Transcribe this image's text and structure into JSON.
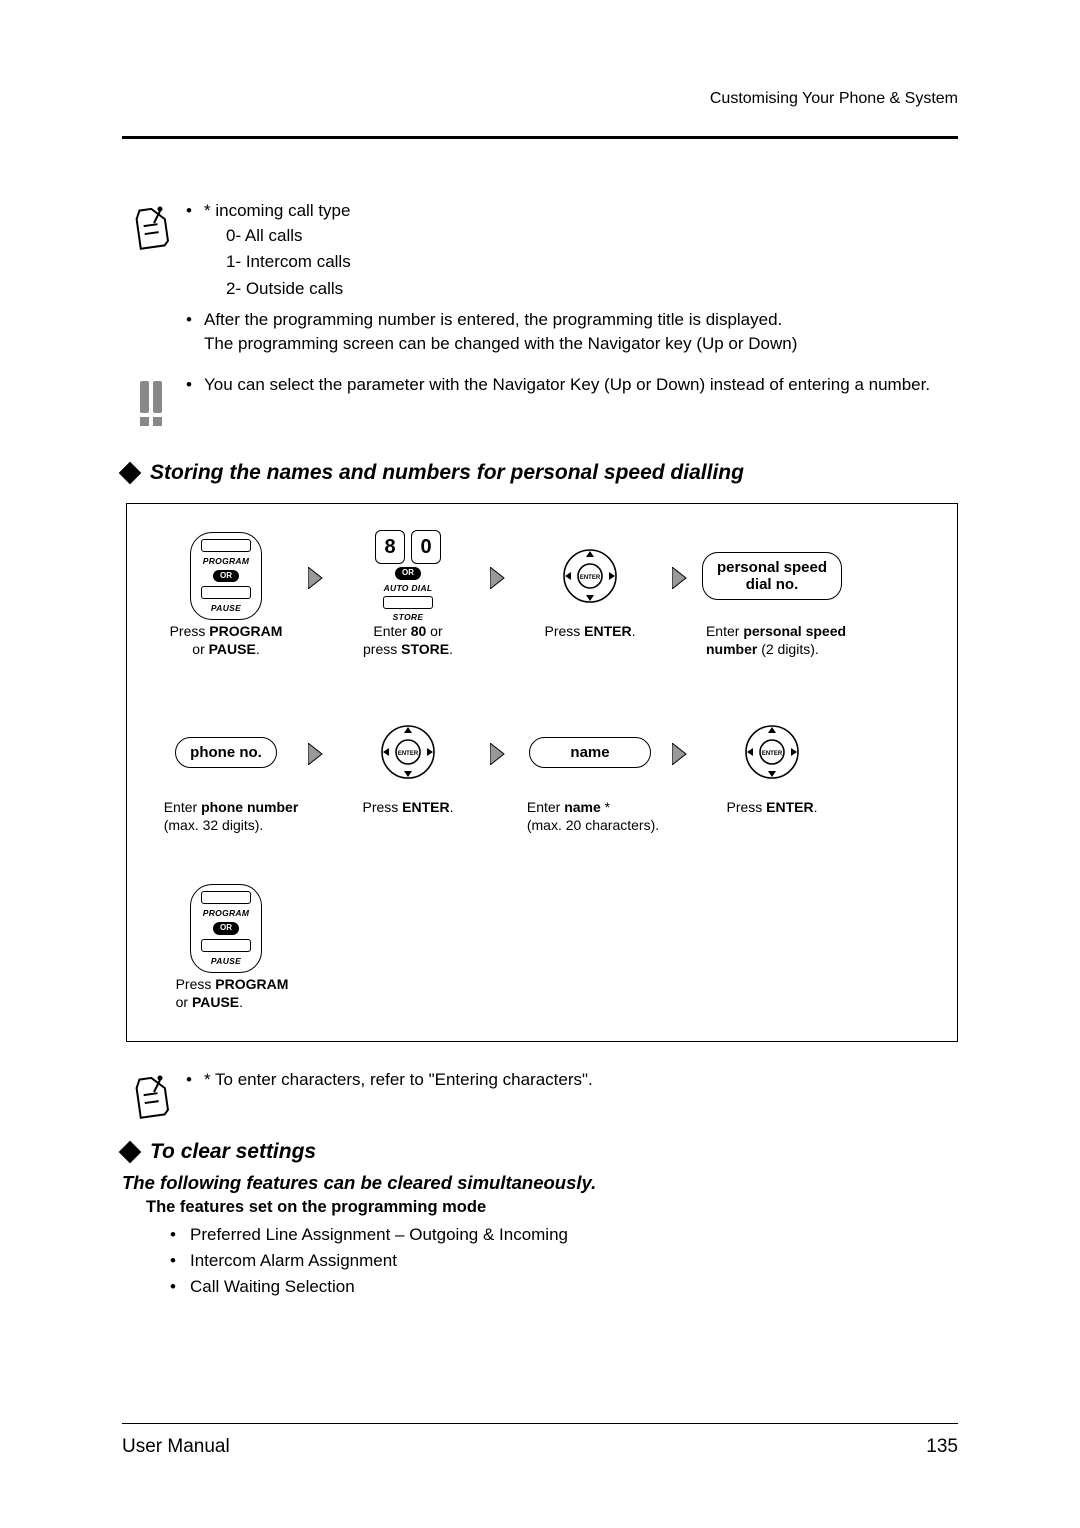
{
  "running_head": "Customising Your Phone & System",
  "note1": {
    "bullet1_lead": "* incoming call type",
    "sub0": "0- All calls",
    "sub1": "1- Intercom calls",
    "sub2": "2- Outside calls",
    "bullet2a": "After the programming number is entered, the programming title is displayed.",
    "bullet2b": "The programming screen can be changed with the Navigator key (Up or Down)"
  },
  "note2": {
    "text": "You can select the parameter with the Navigator Key (Up or Down) instead of entering a number."
  },
  "section1_title": "Storing the names and numbers for personal speed dialling",
  "steps": {
    "r1": {
      "prog_lbl": "PROGRAM",
      "or_lbl": "OR",
      "pause_lbl": "PAUSE",
      "auto_lbl": "AUTO DIAL",
      "store_lbl": "STORE",
      "d8": "8",
      "d0": "0",
      "cap1a": "Press ",
      "cap1b": "PROGRAM",
      "cap1c": "or ",
      "cap1d": "PAUSE",
      "cap1e": ".",
      "cap2a": "Enter ",
      "cap2b": "80",
      "cap2c": " or",
      "cap2d": "press ",
      "cap2e": "STORE",
      "cap2f": ".",
      "cap3a": "Press ",
      "cap3b": "ENTER",
      "cap3c": ".",
      "oval4a": "personal speed",
      "oval4b": "dial no.",
      "cap4a": "Enter ",
      "cap4b": "personal speed",
      "cap4c": "number",
      "cap4d": " (2 digits)."
    },
    "r2": {
      "oval1": "phone no.",
      "cap1a": "Enter ",
      "cap1b": "phone number",
      "cap1c": "(max. 32 digits).",
      "cap2a": "Press ",
      "cap2b": "ENTER",
      "cap2c": ".",
      "oval3": "name",
      "cap3a": "Enter ",
      "cap3b": "name",
      "cap3c": " *",
      "cap3d": "(max. 20 characters).",
      "cap4a": "Press ",
      "cap4b": "ENTER",
      "cap4c": "."
    },
    "r3": {
      "cap1a": "Press ",
      "cap1b": "PROGRAM",
      "cap1c": "or ",
      "cap1d": "PAUSE",
      "cap1e": "."
    }
  },
  "note3": {
    "text": "* To enter characters, refer to \"Entering characters\"."
  },
  "section2_title": "To clear settings",
  "clear": {
    "line1": "The following features can be cleared simultaneously.",
    "line2": "The features set on the programming mode",
    "i1": "Preferred Line Assignment – Outgoing & Incoming",
    "i2": "Intercom Alarm Assignment",
    "i3": "Call Waiting Selection"
  },
  "footer_left": "User Manual",
  "footer_right": "135"
}
